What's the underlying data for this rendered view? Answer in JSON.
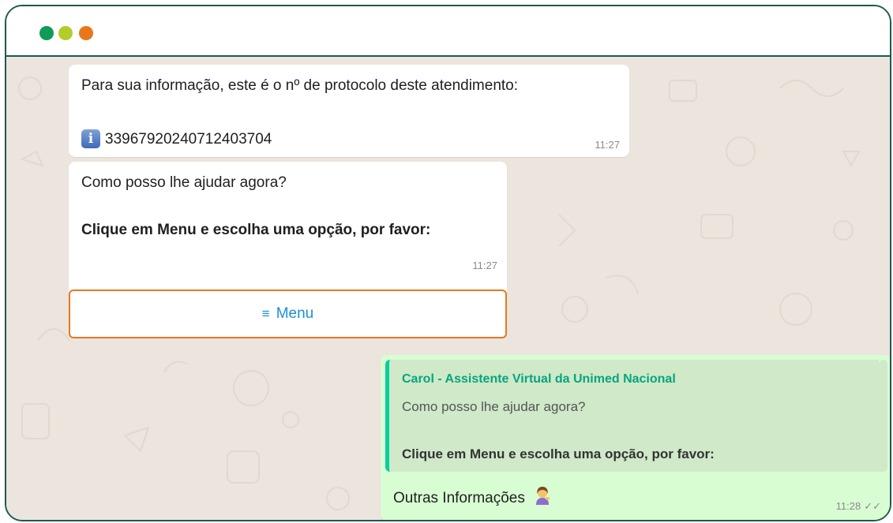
{
  "window": {
    "dots": [
      {
        "name": "green",
        "color": "#0f9b58"
      },
      {
        "name": "lime",
        "color": "#b3cc2b"
      },
      {
        "name": "orange",
        "color": "#e8771c"
      }
    ]
  },
  "messages": {
    "protocol": {
      "text": "Para sua informação, este é o nº de protocolo deste atendimento:",
      "icon": "info-icon",
      "icon_glyph": "i",
      "number": "33967920240712403704",
      "time": "11:27"
    },
    "help": {
      "question": "Como posso lhe ajudar agora?",
      "instruction": "Clique em Menu e escolha uma opção, por favor:",
      "time": "11:27",
      "menu_icon": "≡",
      "menu_label": "Menu"
    },
    "reply": {
      "quote_sender": "Carol - Assistente Virtual da Unimed Nacional",
      "quote_question": "Como posso lhe ajudar agora?",
      "quote_instruction": "Clique em Menu e escolha uma opção, por favor:",
      "text": "Outras Informações",
      "emoji": "person-tipping-hand-emoji",
      "time": "11:28",
      "ticks": "✓✓"
    }
  },
  "colors": {
    "frame": "#1d5a4e",
    "chat_bg": "#ece5dd",
    "outgoing_bubble": "#d9fdd3",
    "quote_bar": "#06cf9c",
    "menu_highlight": "#e87722",
    "link_blue": "#1a8fd8"
  }
}
